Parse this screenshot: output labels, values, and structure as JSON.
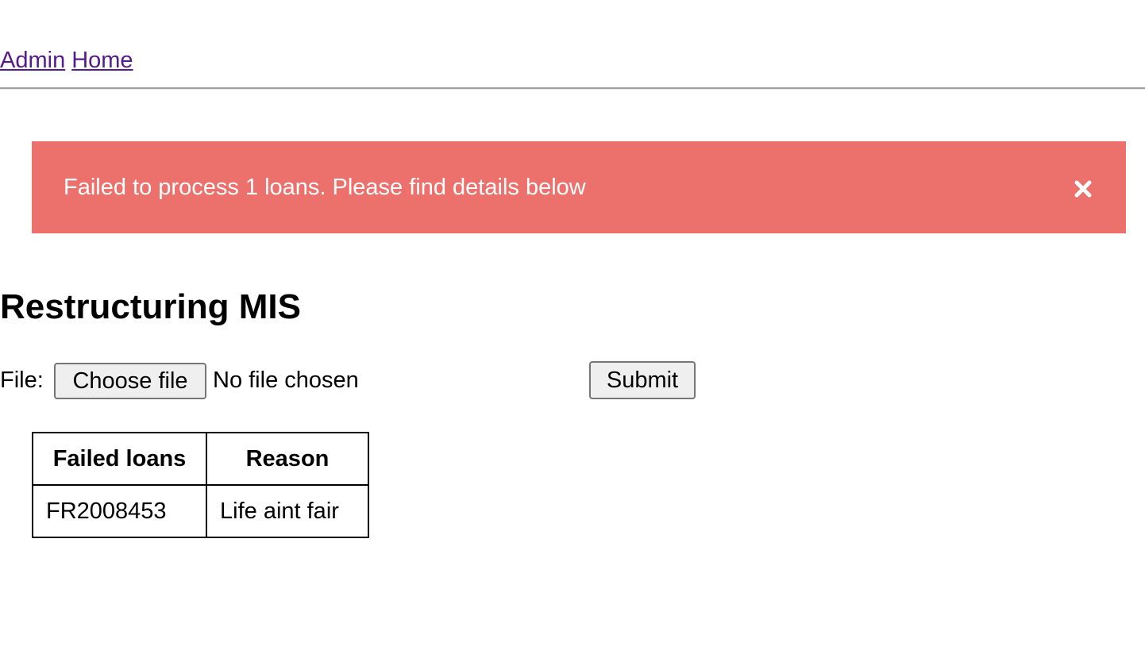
{
  "nav": {
    "links": [
      "Admin",
      "Home"
    ]
  },
  "alert": {
    "message": "Failed to process 1 loans. Please find details below",
    "close_icon": "close-icon",
    "background_color": "#ec706b"
  },
  "page": {
    "title": "Restructuring MIS"
  },
  "form": {
    "file_label": "File:",
    "choose_file_label": "Choose file",
    "file_status": "No file chosen",
    "submit_label": "Submit"
  },
  "failed_table": {
    "headers": [
      "Failed loans",
      "Reason"
    ],
    "rows": [
      [
        "FR2008453",
        "Life aint fair"
      ]
    ]
  }
}
